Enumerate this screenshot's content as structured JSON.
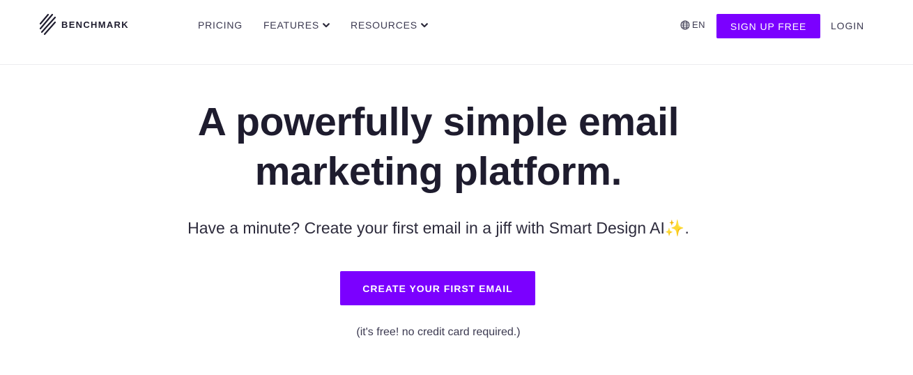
{
  "header": {
    "logo_text": "BENCHMARK",
    "nav": {
      "pricing": "PRICING",
      "features": "FEATURES",
      "resources": "RESOURCES"
    },
    "language": "EN",
    "signup_label": "SIGN UP FREE",
    "login_label": "LOGIN"
  },
  "hero": {
    "title_line1": "A powerfully simple email",
    "title_line2": "marketing platform.",
    "subtitle": "Have a minute? Create your first email in a jiff with Smart Design AI✨.",
    "cta_label": "CREATE YOUR FIRST EMAIL",
    "cta_note": "(it's free! no credit card required.)"
  },
  "colors": {
    "accent": "#7b00ff",
    "text_dark": "#1e1c2e",
    "nav_text": "#3b3950",
    "divider": "#ececef"
  },
  "icons": {
    "logo": "benchmark-slashes-icon",
    "dropdown": "chevron-down-icon",
    "language": "globe-icon"
  }
}
